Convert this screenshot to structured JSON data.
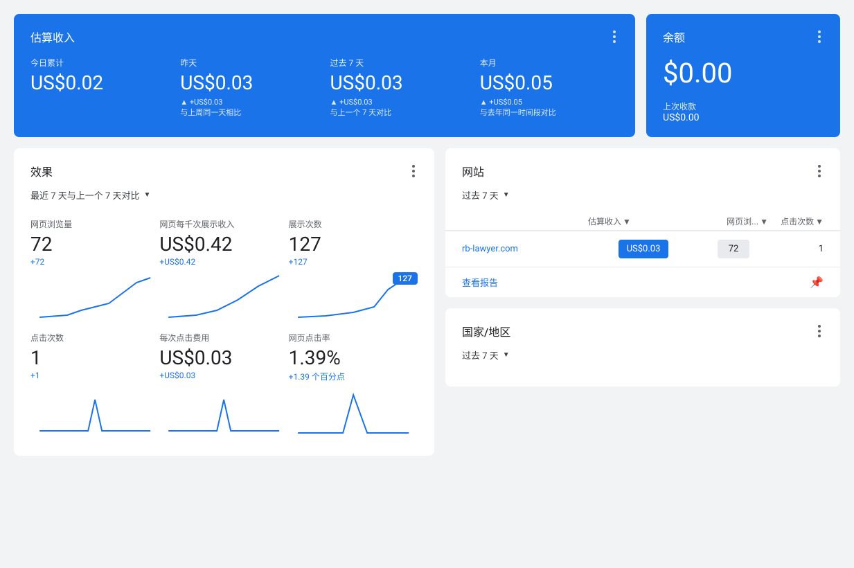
{
  "top": {
    "earnings_card": {
      "title": "估算收入",
      "items": [
        {
          "label": "今日累计",
          "value": "US$0.02",
          "change": "",
          "compare": ""
        },
        {
          "label": "昨天",
          "value": "US$0.03",
          "change": "▲ +US$0.03",
          "compare": "与上周同一天相比"
        },
        {
          "label": "过去 7 天",
          "value": "US$0.03",
          "change": "▲ +US$0.03",
          "compare": "与上一个 7 天对比"
        },
        {
          "label": "本月",
          "value": "US$0.05",
          "change": "▲ +US$0.05",
          "compare": "与去年同一时间段对比"
        }
      ]
    },
    "balance_card": {
      "title": "余额",
      "amount": "$0.00",
      "prev_label": "上次收款",
      "prev_value": "US$0.00"
    }
  },
  "effect": {
    "title": "效果",
    "period": "最近 7 天与上一个 7 天对比",
    "metrics": [
      {
        "label": "网页浏览量",
        "value": "72",
        "change": "+72"
      },
      {
        "label": "网页每千次展示收入",
        "value": "US$0.42",
        "change": "+US$0.42"
      },
      {
        "label": "展示次数",
        "value": "127",
        "change": "+127",
        "tooltip": "127"
      },
      {
        "label": "点击次数",
        "value": "1",
        "change": "+1"
      },
      {
        "label": "每次点击费用",
        "value": "US$0.03",
        "change": "+US$0.03"
      },
      {
        "label": "网页点击率",
        "value": "1.39%",
        "change": "+1.39 个百分点"
      }
    ]
  },
  "site": {
    "title": "网站",
    "period": "过去 7 天",
    "headers": [
      "估算收入",
      "网页浏...",
      "点击次数"
    ],
    "rows": [
      {
        "name": "rb-lawyer.com",
        "earnings": "US$0.03",
        "pageviews": "72",
        "clicks": "1"
      }
    ],
    "see_report": "查看报告"
  },
  "country": {
    "title": "国家/地区",
    "period": "过去 7 天"
  }
}
